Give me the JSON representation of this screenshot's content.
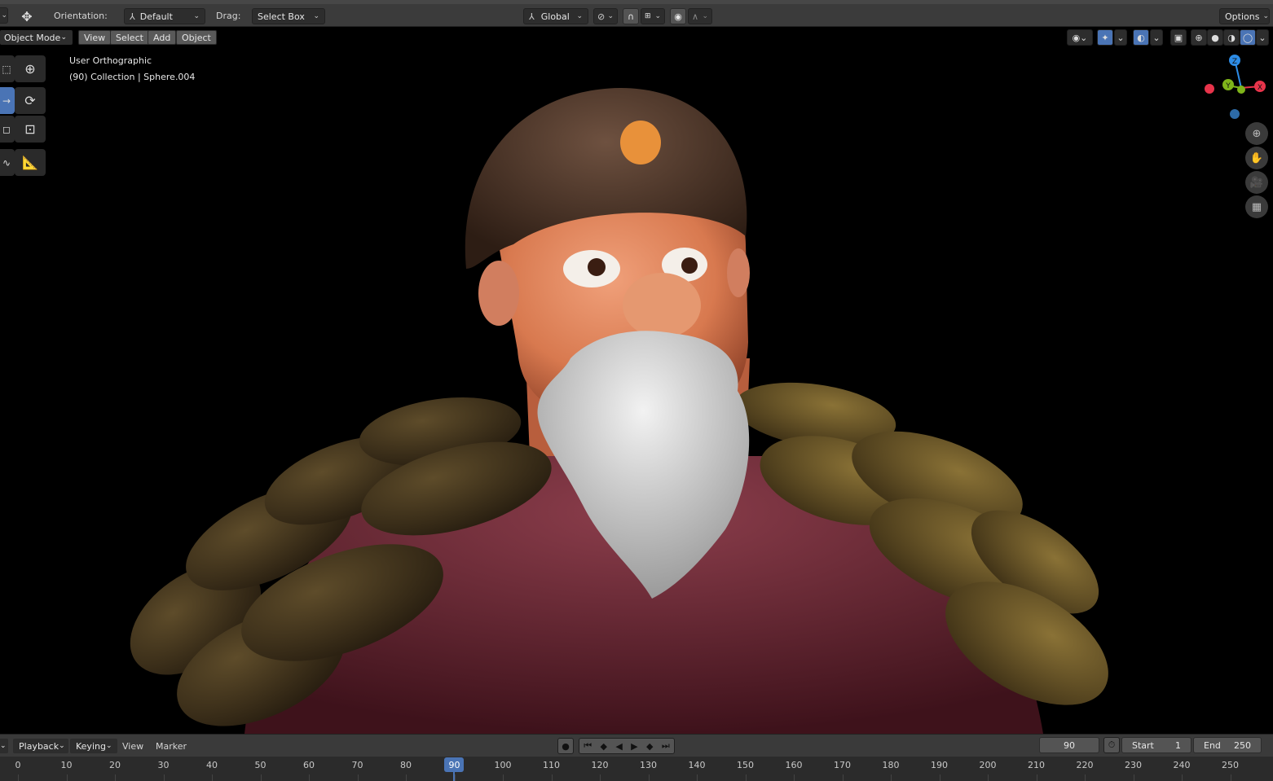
{
  "tool_header": {
    "orientation_label": "Orientation:",
    "orientation_value": "Default",
    "drag_label": "Drag:",
    "drag_value": "Select Box",
    "transform_orientation": "Global",
    "options_label": "Options"
  },
  "viewport_header": {
    "mode": "Object Mode",
    "menus": [
      "View",
      "Select",
      "Add",
      "Object"
    ]
  },
  "viewport": {
    "view_name": "User Orthographic",
    "collection_info": "(90) Collection | Sphere.004",
    "gizmo": {
      "z": "Z",
      "y": "Y",
      "x": "X"
    }
  },
  "timeline": {
    "menus": [
      "Playback",
      "Keying",
      "View",
      "Marker"
    ],
    "current_frame": "90",
    "start_label": "Start",
    "start_value": "1",
    "end_label": "End",
    "end_value": "250",
    "ruler_ticks": [
      "0",
      "10",
      "20",
      "30",
      "40",
      "50",
      "60",
      "70",
      "80",
      "90",
      "100",
      "110",
      "120",
      "130",
      "140",
      "150",
      "160",
      "170",
      "180",
      "190",
      "200",
      "210",
      "220",
      "230",
      "240",
      "250"
    ]
  },
  "colors": {
    "accent": "#4a74b5",
    "axis_x": "#e8344b",
    "axis_y": "#7fb51a",
    "axis_z": "#2d8ce6",
    "header_bg": "#3b3b3b"
  }
}
